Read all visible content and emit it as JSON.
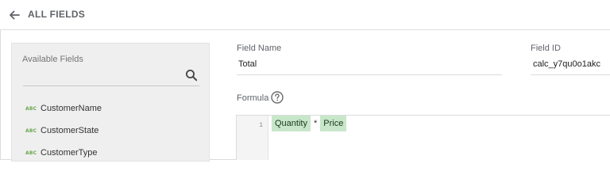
{
  "header": {
    "back_icon": "arrow-left-icon",
    "title": "ALL FIELDS"
  },
  "available_fields": {
    "title": "Available Fields",
    "search_icon": "search-icon",
    "search_value": "",
    "items": [
      {
        "type_badge": "ABC",
        "label": "CustomerName"
      },
      {
        "type_badge": "ABC",
        "label": "CustomerState"
      },
      {
        "type_badge": "ABC",
        "label": "CustomerType"
      }
    ]
  },
  "form": {
    "field_name_label": "Field Name",
    "field_name_value": "Total",
    "field_id_label": "Field ID",
    "field_id_value": "calc_y7qu0o1akc",
    "formula_label": "Formula",
    "help_icon": "help-circle-icon"
  },
  "editor": {
    "line_number": "1",
    "tokens": [
      "Quantity",
      "Price"
    ],
    "operator": "*"
  },
  "colors": {
    "token_bg": "#c8e6c9",
    "badge_green": "#6aa84f",
    "panel_bg": "#efefef"
  }
}
